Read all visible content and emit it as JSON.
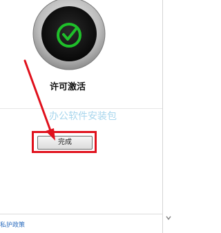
{
  "activation": {
    "title": "许可激活",
    "status_icon": "check-circle-icon",
    "status_color": "#1fbf2a"
  },
  "watermark": {
    "text": "办公软件安装包"
  },
  "actions": {
    "done_label": "完成"
  },
  "annotation": {
    "color": "#e0101c",
    "arrow_icon": "red-arrow-icon"
  },
  "footer": {
    "privacy_link": "私护政策"
  },
  "scroll": {
    "down_icon": "chevron-down-icon"
  }
}
